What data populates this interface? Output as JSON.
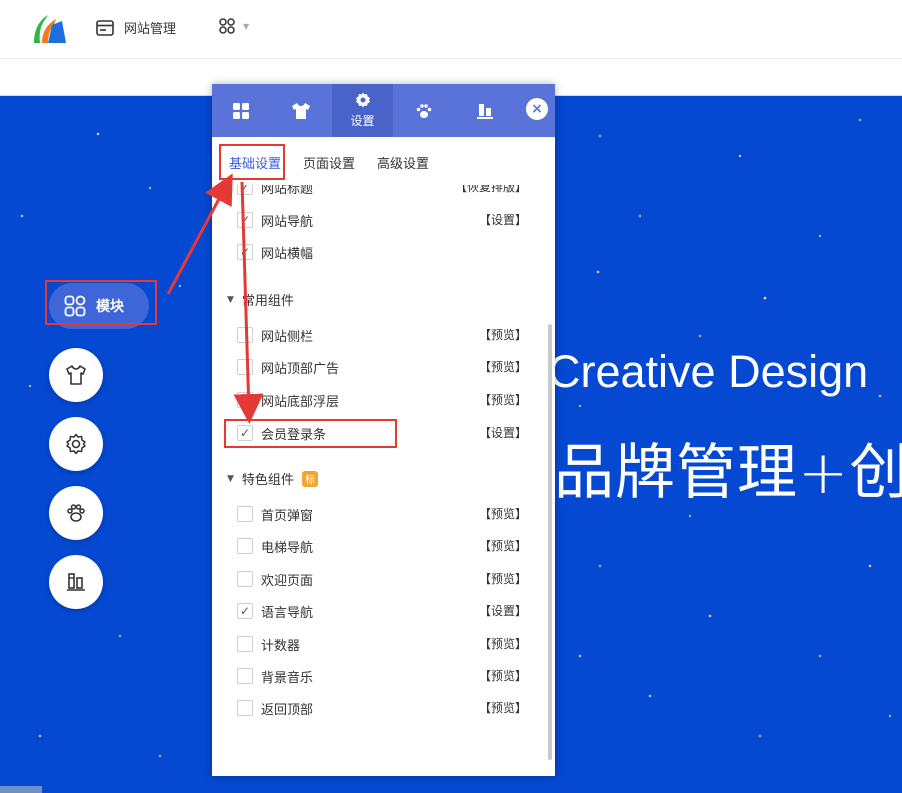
{
  "topbar": {
    "site_manage_label": "网站管理"
  },
  "hero": {
    "title_en": "Creative Design",
    "title_cn": "品牌管理+创意"
  },
  "left_tools": {
    "module_label": "模块"
  },
  "panel": {
    "tabs": [
      {
        "icon": "grid-icon",
        "label": ""
      },
      {
        "icon": "shirt-icon",
        "label": ""
      },
      {
        "icon": "gear-icon",
        "label": "设置",
        "active": true
      },
      {
        "icon": "paw-icon",
        "label": ""
      },
      {
        "icon": "books-icon",
        "label": ""
      }
    ],
    "subtabs": [
      "基础设置",
      "页面设置",
      "高级设置"
    ],
    "top_items": [
      {
        "name": "网站标题",
        "checked": true,
        "action": "【恢复排版】"
      },
      {
        "name": "网站导航",
        "checked": true,
        "action": "【设置】"
      },
      {
        "name": "网站横幅",
        "checked": true,
        "action": ""
      }
    ],
    "group_common": {
      "title": "常用组件",
      "items": [
        {
          "name": "网站侧栏",
          "checked": false,
          "action": "【预览】"
        },
        {
          "name": "网站顶部广告",
          "checked": false,
          "action": "【预览】"
        },
        {
          "name": "网站底部浮层",
          "checked": false,
          "action": "【预览】"
        },
        {
          "name": "会员登录条",
          "checked": true,
          "action": "【设置】"
        }
      ]
    },
    "group_featured": {
      "title": "特色组件",
      "badge": "标",
      "items": [
        {
          "name": "首页弹窗",
          "checked": false,
          "action": "【预览】"
        },
        {
          "name": "电梯导航",
          "checked": false,
          "action": "【预览】"
        },
        {
          "name": "欢迎页面",
          "checked": false,
          "action": "【预览】"
        },
        {
          "name": "语言导航",
          "checked": true,
          "action": "【设置】"
        },
        {
          "name": "计数器",
          "checked": false,
          "action": "【预览】"
        },
        {
          "name": "背景音乐",
          "checked": false,
          "action": "【预览】"
        },
        {
          "name": "返回顶部",
          "checked": false,
          "action": "【预览】"
        }
      ]
    }
  },
  "colors": {
    "hero_blue": "#0548d2",
    "panel_blue": "#5a73d8",
    "highlight_red": "#e53935",
    "active_link": "#3b5bdb"
  }
}
